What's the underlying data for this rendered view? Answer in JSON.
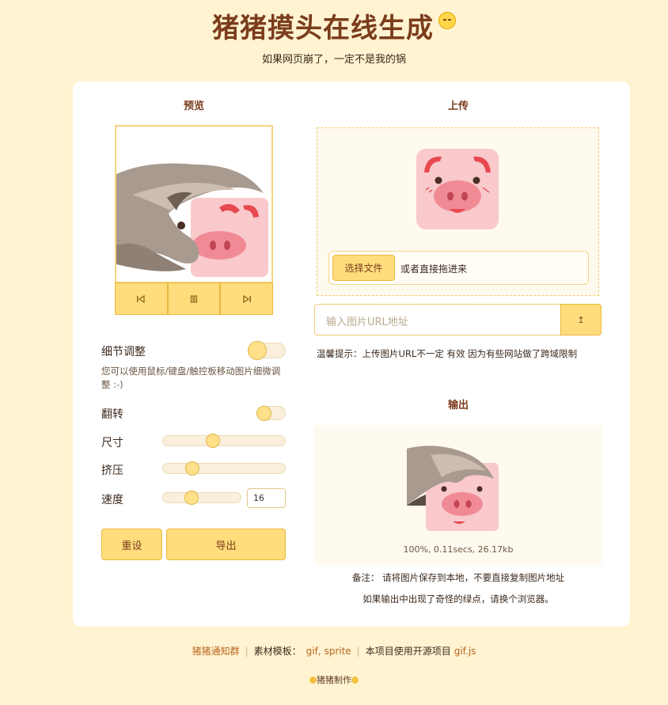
{
  "header": {
    "title": "猪猪摸头在线生成",
    "subtitle": "如果网页崩了，一定不是我的锅"
  },
  "left": {
    "section_title": "预览",
    "controls": {
      "prev_icon": "skip-back-icon",
      "pause_icon": "pause-icon",
      "next_icon": "skip-forward-icon"
    },
    "detail_label": "细节调整",
    "detail_toggle_on": false,
    "detail_hint": "您可以使用鼠标/键盘/触控板移动图片细微调整 :-)",
    "flip_label": "翻转",
    "flip_toggle_on": false,
    "size_label": "尺寸",
    "size_level": 0.41,
    "squeeze_label": "挤压",
    "squeeze_level": 0.24,
    "speed_label": "速度",
    "speed_level": 0.37,
    "speed_value": "16",
    "reset_label": "重设",
    "export_label": "导出"
  },
  "right": {
    "upload_title": "上传",
    "choose_file_label": "选择文件",
    "drag_hint": "或者直接拖进来",
    "url_placeholder": "输入图片URL地址",
    "url_button_icon": "upload-icon",
    "url_button_glyph": "↥",
    "tip": "温馨提示：上传图片URL不一定 有效 因为有些网站做了跨域限制",
    "output_title": "输出",
    "output_info": "100%, 0.11secs, 26.17kb",
    "note1": "备注： 请将图片保存到本地，不要直接复制图片地址",
    "note2": "如果输出中出现了奇怪的绿点，请换个浏览器。"
  },
  "footer": {
    "group_link": "猪猪通知群",
    "template_label": "素材模板：",
    "template_links": "gif, sprite",
    "opensource_label": "本项目使用开源项目",
    "opensource_link": "gif.js",
    "credit": "猪猪制作"
  },
  "colors": {
    "background": "#fff3d1",
    "accent": "#ffdc7c",
    "title": "#7b3d1c"
  }
}
